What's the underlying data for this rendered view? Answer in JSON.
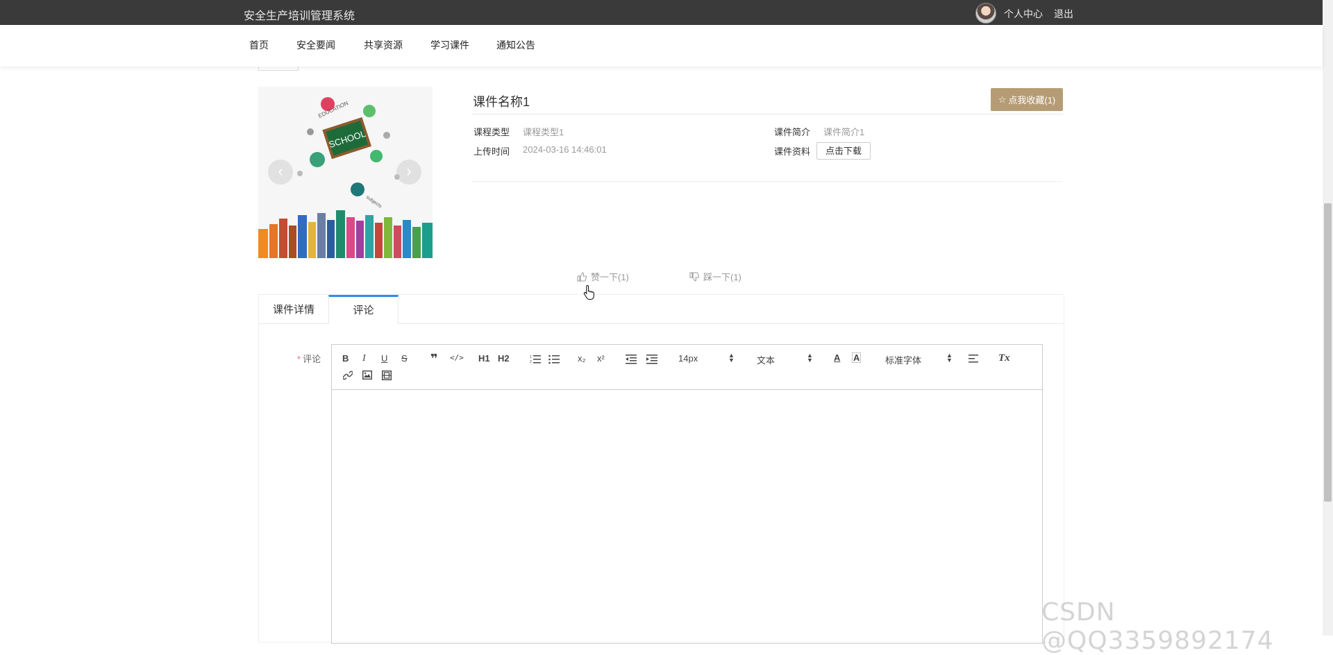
{
  "app": {
    "title": "安全生产培训管理系统",
    "user_center": "个人中心",
    "logout": "退出"
  },
  "nav": {
    "items": [
      "首页",
      "安全要闻",
      "共享资源",
      "学习课件",
      "通知公告"
    ]
  },
  "course": {
    "name": "课件名称1",
    "collect_label": "点我收藏(1)",
    "type_label": "课程类型",
    "type_value": "课程类型1",
    "upload_label": "上传时间",
    "upload_value": "2024-03-16 14:46:01",
    "intro_label": "课件简介",
    "intro_value": "课件简介1",
    "material_label": "课件资料",
    "download_label": "点击下载"
  },
  "image_text": {
    "school": "SCHOOL",
    "education": "EDUCATION",
    "subjects": "subjects"
  },
  "votes": {
    "like": "赞一下(1)",
    "dislike": "踩一下(1)"
  },
  "tabs": [
    {
      "label": "课件详情",
      "active": false
    },
    {
      "label": "评论",
      "active": true
    }
  ],
  "comment": {
    "required_mark": "*",
    "label": "评论",
    "editor": {
      "font_size": "14px",
      "block_type": "文本",
      "font_family": "标准字体",
      "buttons": [
        "bold-icon",
        "italic-icon",
        "underline-icon",
        "strike-icon",
        "quote-icon",
        "code-icon",
        "h1-icon",
        "h2-icon",
        "ordered-list-icon",
        "bullet-list-icon",
        "subscript-icon",
        "superscript-icon",
        "outdent-icon",
        "indent-icon",
        "font-color-icon",
        "background-color-icon",
        "align-icon",
        "clear-format-icon",
        "link-icon",
        "image-icon",
        "video-icon"
      ],
      "text": {
        "bold": "B",
        "italic": "I",
        "underline": "U",
        "strike": "S",
        "h1": "H1",
        "h2": "H2",
        "sub": "x₂",
        "sup": "x²",
        "font_color": "A",
        "bg_color": "A",
        "clear": "Tx"
      }
    }
  },
  "watermark": "CSDN @QQ3359892174",
  "colors": {
    "topbar": "#3a3a3a",
    "accent": "#b59c74",
    "tab_active": "#2e8ded"
  }
}
